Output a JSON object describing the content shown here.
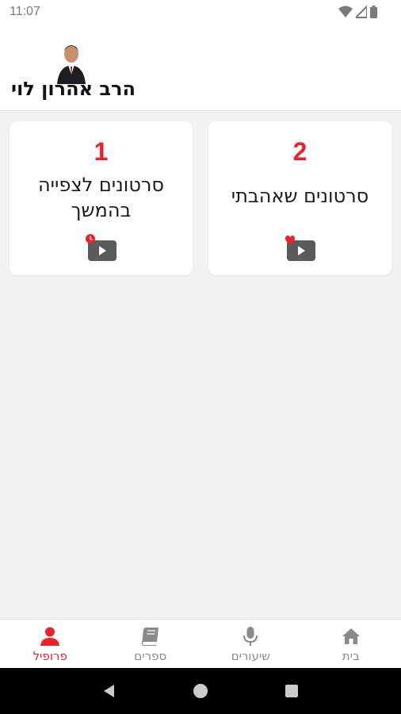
{
  "status": {
    "time": "11:07"
  },
  "header": {
    "title": "הרב אהרון לוי"
  },
  "cards": [
    {
      "count": "2",
      "label": "סרטונים שאהבתי",
      "icon": "video-heart-icon"
    },
    {
      "count": "1",
      "label": "סרטונים לצפייה בהמשך",
      "icon": "video-clock-icon"
    }
  ],
  "nav": {
    "items": [
      {
        "label": "בית",
        "icon": "home-icon"
      },
      {
        "label": "שיעורים",
        "icon": "microphone-icon"
      },
      {
        "label": "ספרים",
        "icon": "book-icon"
      },
      {
        "label": "פרופיל",
        "icon": "person-icon",
        "active": true
      }
    ]
  },
  "colors": {
    "accent": "#e8232a",
    "inactive": "#8a8a8a",
    "background": "#f2f2f2"
  }
}
